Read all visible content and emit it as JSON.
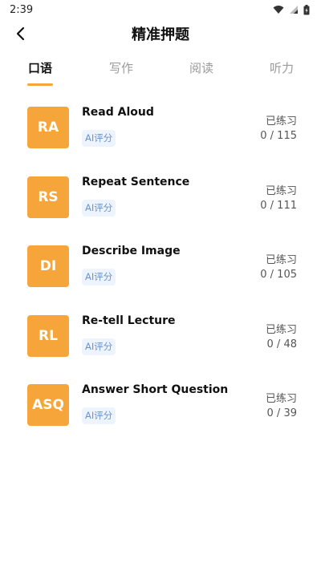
{
  "status_bar": {
    "time": "2:39",
    "icons": [
      "wifi-icon",
      "signal-icon",
      "battery-icon"
    ]
  },
  "header": {
    "title": "精准押题",
    "back_icon": "chevron-left-icon"
  },
  "tabs": [
    {
      "label": "口语",
      "active": true
    },
    {
      "label": "写作",
      "active": false
    },
    {
      "label": "阅读",
      "active": false
    },
    {
      "label": "听力",
      "active": false
    }
  ],
  "items": [
    {
      "abbr": "RA",
      "name": "Read Aloud",
      "tag": "AI评分",
      "practiced_label": "已练习",
      "count": "0 / 115"
    },
    {
      "abbr": "RS",
      "name": "Repeat Sentence",
      "tag": "AI评分",
      "practiced_label": "已练习",
      "count": "0 / 111"
    },
    {
      "abbr": "DI",
      "name": "Describe Image",
      "tag": "AI评分",
      "practiced_label": "已练习",
      "count": "0 / 105"
    },
    {
      "abbr": "RL",
      "name": "Re-tell Lecture",
      "tag": "AI评分",
      "practiced_label": "已练习",
      "count": "0 / 48"
    },
    {
      "abbr": "ASQ",
      "name": "Answer Short Question",
      "tag": "AI评分",
      "practiced_label": "已练习",
      "count": "0 / 39"
    }
  ],
  "colors": {
    "accent": "#f6a53a",
    "tag_bg": "#eef4fd",
    "tag_text": "#6a93cf"
  }
}
